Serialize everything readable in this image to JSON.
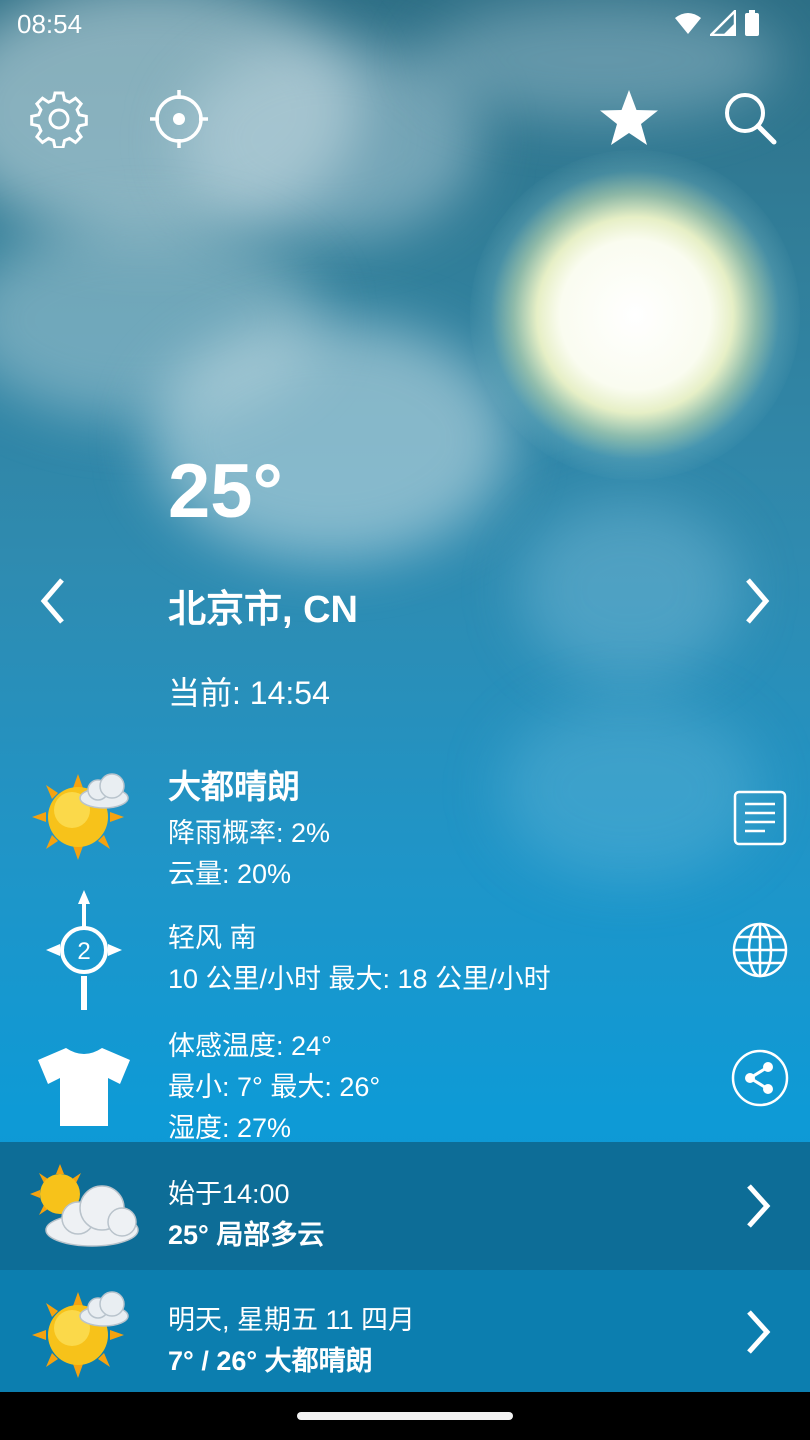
{
  "status_bar": {
    "time": "08:54",
    "icons": [
      "wifi-icon",
      "signal-icon",
      "battery-icon"
    ]
  },
  "toolbar": {
    "icons": [
      "settings-icon",
      "location-icon",
      "favorite-star-icon",
      "search-icon"
    ]
  },
  "current": {
    "temperature": "25°",
    "city": "北京市, CN",
    "updated": "当前: 14:54",
    "condition": "大都晴朗",
    "precip": "降雨概率: 2%",
    "cloud": "云量: 20%",
    "wind_title": "轻风 南",
    "wind_detail": "10 公里/小时 最大: 18 公里/小时",
    "wind_force": "2",
    "feels_like": "体感温度: 24°",
    "min_max": "最小: 7° 最大: 26°",
    "humidity": "湿度: 27%"
  },
  "forecast": [
    {
      "line1": "始于14:00",
      "line2": "25° 局部多云",
      "icon": "partly-cloudy-icon"
    },
    {
      "line1": "明天, 星期五 11 四月",
      "line2": "7° / 26° 大都晴朗",
      "icon": "mostly-sunny-icon"
    }
  ],
  "colors": {
    "accent": "#0e9ad6",
    "row_dark": "#0d6d97",
    "row_mid": "#0c7eaf",
    "sun": "#f7c21a"
  }
}
